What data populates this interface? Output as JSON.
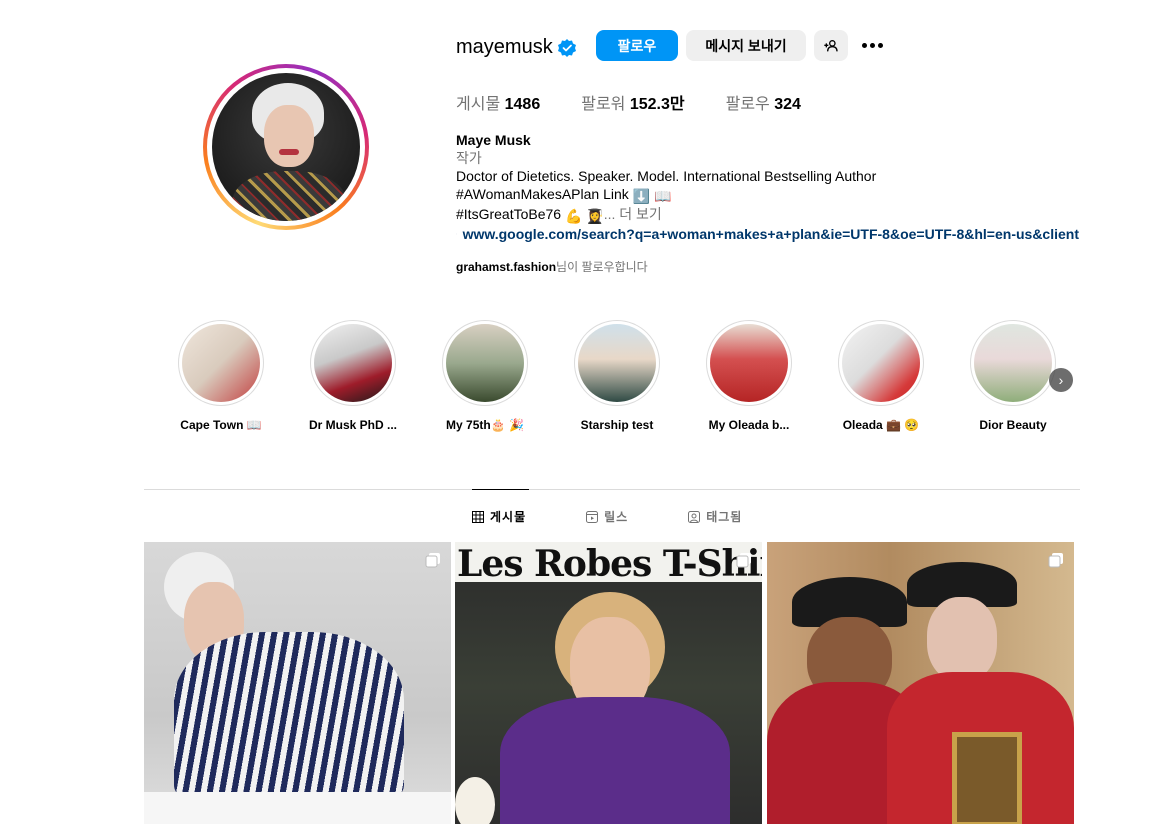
{
  "profile": {
    "username": "mayemusk",
    "follow_label": "팔로우",
    "message_label": "메시지 보내기",
    "suggest_icon": "person-add-icon",
    "more_icon": "more-horizontal-icon",
    "stats": [
      {
        "label": "게시물",
        "value": "1486"
      },
      {
        "label": "팔로워",
        "value": "152.3만"
      },
      {
        "label": "팔로우",
        "value": "324"
      }
    ],
    "full_name": "Maye Musk",
    "category": "작가",
    "bio_line1": "Doctor of Dietetics. Speaker. Model. International Bestselling Author",
    "bio_line2": "#AWomanMakesAPlan Link",
    "bio_line2_emojis": "⬇️ 📖",
    "bio_line3": "#ItsGreatToBe76",
    "bio_line3_emojis": "💪 👩‍🎓",
    "bio_more": "... 더 보기",
    "link": "www.google.com/search?q=a+woman+makes+a+plan&ie=UTF-8&oe=UTF-8&hl=en-us&client",
    "followed_by_user": "grahamst.fashion",
    "followed_by_suffix": "님이 팔로우합니다"
  },
  "highlights": [
    {
      "label": "Cape Town 📖"
    },
    {
      "label": "Dr Musk PhD ..."
    },
    {
      "label": "My 75th🎂 🎉"
    },
    {
      "label": "Starship test"
    },
    {
      "label": "My Oleada b..."
    },
    {
      "label": "Oleada 💼 🥺"
    },
    {
      "label": "Dior Beauty"
    }
  ],
  "tabs": [
    {
      "label": "게시물",
      "icon": "grid-icon",
      "active": true
    },
    {
      "label": "릴스",
      "icon": "reels-icon",
      "active": false
    },
    {
      "label": "태그됨",
      "icon": "tagged-icon",
      "active": false
    }
  ],
  "posts": [
    {
      "type": "carousel",
      "icon": "carousel-icon"
    },
    {
      "type": "carousel",
      "icon": "carousel-icon",
      "headline": "Les Robes T-Shirt"
    },
    {
      "type": "carousel",
      "icon": "carousel-icon"
    }
  ],
  "colors": {
    "accent": "#0095f6",
    "secondary_button": "#efefef",
    "muted_text": "#737373",
    "link": "#00376b"
  }
}
